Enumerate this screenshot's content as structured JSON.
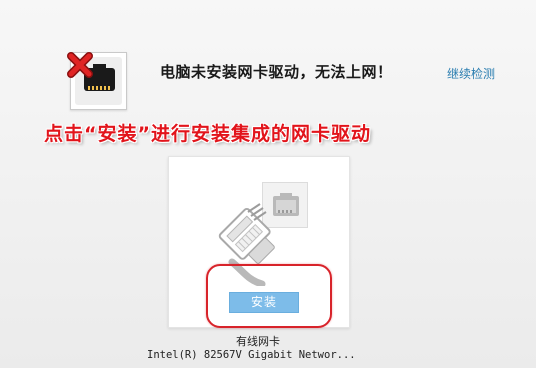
{
  "status": {
    "message": "电脑未安装网卡驱动，无法上网！",
    "continue_link": "继续检测",
    "icon": "network-port-icon",
    "error_icon": "red-x-icon"
  },
  "instruction": {
    "text": "点击“安装”进行安装集成的网卡驱动",
    "color": "#e2141b"
  },
  "driver": {
    "port_icon": "ethernet-port-icon",
    "cable_icon": "ethernet-cable-icon",
    "install_label": "安装",
    "install_color": "#7dbce9",
    "highlight_color": "#d8232a",
    "device_type": "有线网卡",
    "device_name": "Intel(R) 82567V Gigabit Networ..."
  }
}
